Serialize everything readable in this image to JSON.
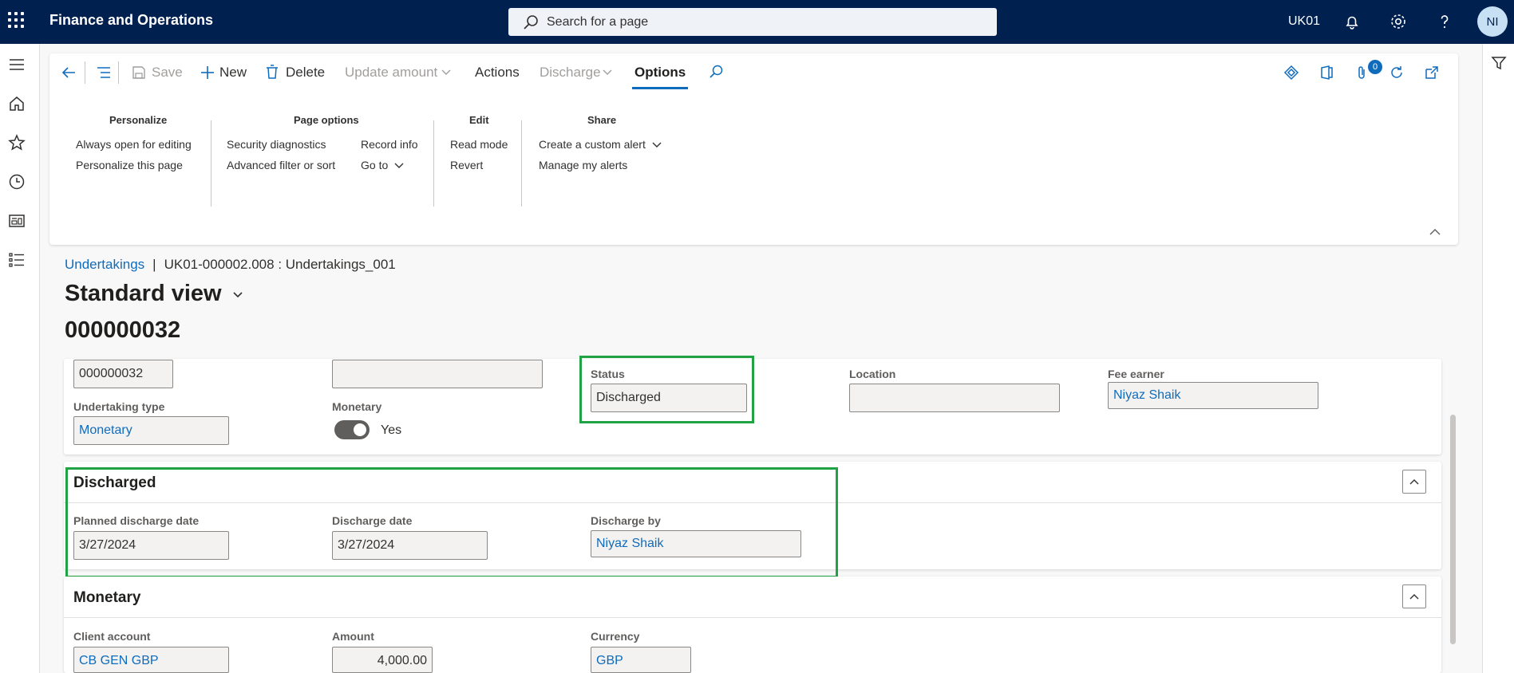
{
  "topbar": {
    "app_title": "Finance and Operations",
    "search_placeholder": "Search for a page",
    "company": "UK01",
    "avatar_initials": "NI"
  },
  "actionpane": {
    "save": "Save",
    "new": "New",
    "delete": "Delete",
    "update_amount": "Update amount",
    "actions": "Actions",
    "discharge": "Discharge",
    "options": "Options",
    "badge_count": "0",
    "groups": {
      "personalize": {
        "title": "Personalize",
        "items": [
          "Always open for editing",
          "Personalize this page"
        ]
      },
      "page_options": {
        "title": "Page options",
        "items": [
          "Security diagnostics",
          "Advanced filter or sort",
          "Record info",
          "Go to"
        ]
      },
      "edit": {
        "title": "Edit",
        "items": [
          "Read mode",
          "Revert"
        ]
      },
      "share": {
        "title": "Share",
        "items": [
          "Create a custom alert",
          "Manage my alerts"
        ]
      }
    }
  },
  "breadcrumb": {
    "link": "Undertakings",
    "separator": "|",
    "current": "UK01-000002.008 : Undertakings_001"
  },
  "page": {
    "view_title": "Standard view",
    "record_id": "000000032"
  },
  "general": {
    "id_value": "000000032",
    "blank_value": "",
    "status_label": "Status",
    "status_value": "Discharged",
    "location_label": "Location",
    "location_value": "",
    "fee_earner_label": "Fee earner",
    "fee_earner_value": "Niyaz Shaik",
    "undertaking_type_label": "Undertaking type",
    "undertaking_type_value": "Monetary",
    "monetary_label": "Monetary",
    "monetary_value": "Yes"
  },
  "discharged": {
    "title": "Discharged",
    "planned_label": "Planned discharge date",
    "planned_value": "3/27/2024",
    "date_label": "Discharge date",
    "date_value": "3/27/2024",
    "by_label": "Discharge by",
    "by_value": "Niyaz Shaik"
  },
  "monetary": {
    "title": "Monetary",
    "client_label": "Client account",
    "client_value": "CB GEN GBP",
    "amount_label": "Amount",
    "amount_value": "4,000.00",
    "currency_label": "Currency",
    "currency_value": "GBP"
  },
  "colors": {
    "topbar": "#002050",
    "accent": "#0f6cbd",
    "highlight": "#21a345"
  }
}
